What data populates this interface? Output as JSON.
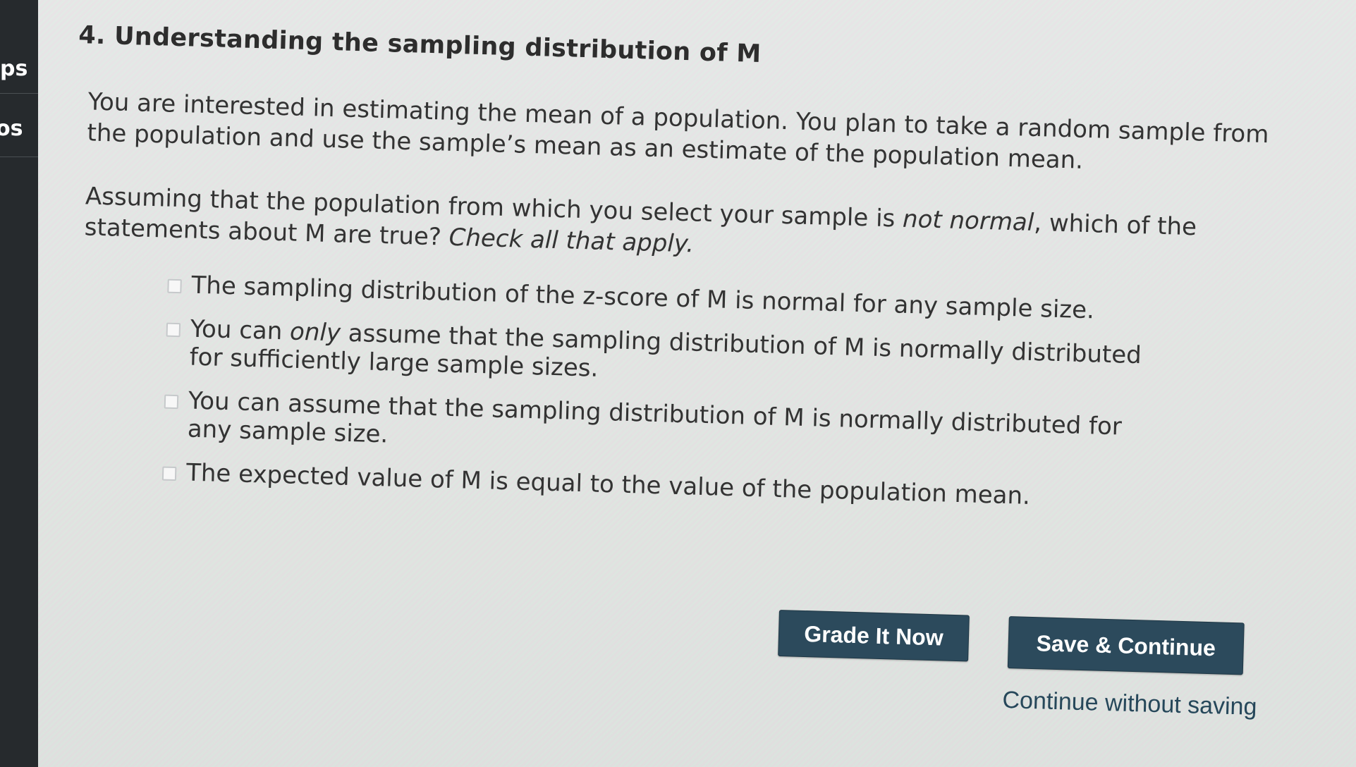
{
  "sidebar": {
    "items": [
      {
        "label": "ps"
      },
      {
        "label": "os"
      }
    ]
  },
  "question": {
    "number_title": "4. Understanding the sampling distribution of M",
    "paragraph1": "You are interested in estimating the mean of a population. You plan to take a random sample from the population and use the sample’s mean as an estimate of the population mean.",
    "paragraph2_parts": {
      "a": "Assuming that the population from which you select your sample is ",
      "b_italic": "not normal",
      "c": ", which of the statements about M are true? ",
      "d_italic": "Check all that apply."
    },
    "options": [
      {
        "parts": {
          "a": "The sampling distribution of the z-score of M is normal for any sample size.",
          "b_italic": "",
          "c": ""
        },
        "checked": false
      },
      {
        "parts": {
          "a": "You can ",
          "b_italic": "only",
          "c": " assume that the sampling distribution of M is normally distributed for sufficiently large sample sizes."
        },
        "checked": false
      },
      {
        "parts": {
          "a": "You can assume that the sampling distribution of M is normally distributed for any sample size.",
          "b_italic": "",
          "c": ""
        },
        "checked": false
      },
      {
        "parts": {
          "a": "The expected value of M is equal to the value of the population mean.",
          "b_italic": "",
          "c": ""
        },
        "checked": false
      }
    ]
  },
  "actions": {
    "grade_label": "Grade It Now",
    "save_label": "Save & Continue",
    "continue_link": "Continue without saving"
  },
  "colors": {
    "button_bg": "#2c4a5c",
    "link": "#26475a",
    "sidebar_bg": "#262a2d"
  }
}
